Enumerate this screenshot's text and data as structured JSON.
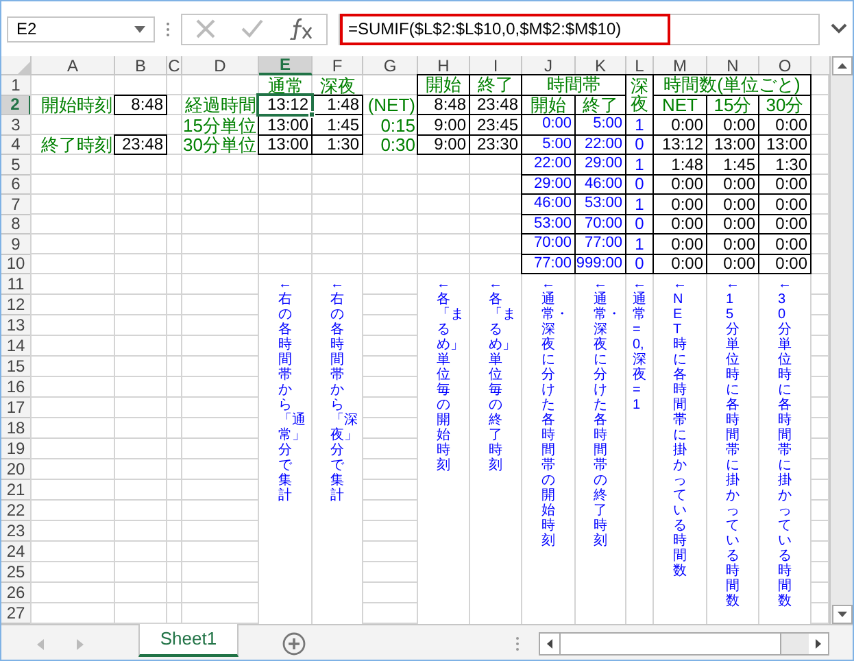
{
  "formula_bar": {
    "name_box": "E2",
    "formula": "=SUMIF($L$2:$L$10,0,$M$2:$M$10)",
    "formula_highlighted": true
  },
  "columns": [
    {
      "label": "A",
      "selected": false
    },
    {
      "label": "B",
      "selected": false
    },
    {
      "label": "C",
      "selected": false
    },
    {
      "label": "D",
      "selected": false
    },
    {
      "label": "E",
      "selected": true
    },
    {
      "label": "F",
      "selected": false
    },
    {
      "label": "G",
      "selected": false
    },
    {
      "label": "H",
      "selected": false
    },
    {
      "label": "I",
      "selected": false
    },
    {
      "label": "J",
      "selected": false
    },
    {
      "label": "K",
      "selected": false
    },
    {
      "label": "L",
      "selected": false
    },
    {
      "label": "M",
      "selected": false
    },
    {
      "label": "N",
      "selected": false
    },
    {
      "label": "O",
      "selected": false
    }
  ],
  "rows": [
    {
      "label": "1",
      "selected": false,
      "cells": {
        "E": {
          "kind": "heading",
          "text": "通常",
          "selected": false
        },
        "F": {
          "kind": "heading",
          "text": "深夜",
          "selected": false
        },
        "H": {
          "kind": "header",
          "text": "開始",
          "selected": false
        },
        "I": {
          "kind": "header",
          "text": "終了",
          "selected": false
        },
        "J": {
          "kind": "header",
          "text": "時間帯",
          "selected": false
        },
        "K": {
          "merged_left": true
        },
        "L": {
          "kind": "header",
          "text": "深夜",
          "selected": false
        },
        "M": {
          "kind": "header",
          "text": "時間数(単位ごと)",
          "selected": false
        },
        "N": {
          "merged_left": true
        },
        "O": {
          "merged_left": true
        }
      }
    },
    {
      "label": "2",
      "selected": true,
      "cells": {
        "A": {
          "kind": "label",
          "text": "開始時刻",
          "selected": false
        },
        "B": {
          "kind": "value",
          "text": "8:48",
          "selected": false
        },
        "D": {
          "kind": "label",
          "text": "経過時間",
          "selected": false
        },
        "E": {
          "kind": "value",
          "text": "13:12",
          "selected": true
        },
        "F": {
          "kind": "value",
          "text": "1:48",
          "selected": false
        },
        "G": {
          "kind": "label",
          "text": "(NET)",
          "selected": false
        },
        "H": {
          "kind": "value",
          "text": "8:48",
          "selected": false
        },
        "I": {
          "kind": "value",
          "text": "23:48",
          "selected": false
        },
        "J": {
          "kind": "header",
          "text": "開始",
          "selected": false
        },
        "K": {
          "kind": "header",
          "text": "終了",
          "selected": false
        },
        "L": {
          "merged_up": true
        },
        "M": {
          "kind": "header",
          "text": "NET",
          "selected": false
        },
        "N": {
          "kind": "header",
          "text": "15分",
          "selected": false
        },
        "O": {
          "kind": "header",
          "text": "30分",
          "selected": false
        }
      }
    },
    {
      "label": "3",
      "selected": false,
      "cells": {
        "D": {
          "kind": "label",
          "text": "15分単位",
          "selected": false
        },
        "E": {
          "kind": "value",
          "text": "13:00",
          "selected": false
        },
        "F": {
          "kind": "value",
          "text": "1:45",
          "selected": false
        },
        "G": {
          "kind": "label",
          "text": "0:15",
          "selected": false
        },
        "H": {
          "kind": "value",
          "text": "9:00",
          "selected": false
        },
        "I": {
          "kind": "value",
          "text": "23:45",
          "selected": false
        },
        "J": {
          "kind": "band",
          "text": "0:00",
          "selected": false
        },
        "K": {
          "kind": "band",
          "text": "5:00",
          "selected": false
        },
        "L": {
          "kind": "flag",
          "text": "1",
          "selected": false
        },
        "M": {
          "kind": "value",
          "text": "0:00",
          "selected": false
        },
        "N": {
          "kind": "value",
          "text": "0:00",
          "selected": false
        },
        "O": {
          "kind": "value",
          "text": "0:00",
          "selected": false
        }
      }
    },
    {
      "label": "4",
      "selected": false,
      "cells": {
        "A": {
          "kind": "label",
          "text": "終了時刻",
          "selected": false
        },
        "B": {
          "kind": "value",
          "text": "23:48",
          "selected": false
        },
        "D": {
          "kind": "label",
          "text": "30分単位",
          "selected": false
        },
        "E": {
          "kind": "value",
          "text": "13:00",
          "selected": false
        },
        "F": {
          "kind": "value",
          "text": "1:30",
          "selected": false
        },
        "G": {
          "kind": "label",
          "text": "0:30",
          "selected": false
        },
        "H": {
          "kind": "value",
          "text": "9:00",
          "selected": false
        },
        "I": {
          "kind": "value",
          "text": "23:30",
          "selected": false
        },
        "J": {
          "kind": "band",
          "text": "5:00",
          "selected": false
        },
        "K": {
          "kind": "band",
          "text": "22:00",
          "selected": false
        },
        "L": {
          "kind": "flag",
          "text": "0",
          "selected": false
        },
        "M": {
          "kind": "value",
          "text": "13:12",
          "selected": false
        },
        "N": {
          "kind": "value",
          "text": "13:00",
          "selected": false
        },
        "O": {
          "kind": "value",
          "text": "13:00",
          "selected": false
        }
      }
    },
    {
      "label": "5",
      "selected": false,
      "cells": {
        "J": {
          "kind": "band",
          "text": "22:00",
          "selected": false
        },
        "K": {
          "kind": "band",
          "text": "29:00",
          "selected": false
        },
        "L": {
          "kind": "flag",
          "text": "1",
          "selected": false
        },
        "M": {
          "kind": "value",
          "text": "1:48",
          "selected": false
        },
        "N": {
          "kind": "value",
          "text": "1:45",
          "selected": false
        },
        "O": {
          "kind": "value",
          "text": "1:30",
          "selected": false
        }
      }
    },
    {
      "label": "6",
      "selected": false,
      "cells": {
        "J": {
          "kind": "band",
          "text": "29:00",
          "selected": false
        },
        "K": {
          "kind": "band",
          "text": "46:00",
          "selected": false
        },
        "L": {
          "kind": "flag",
          "text": "0",
          "selected": false
        },
        "M": {
          "kind": "value",
          "text": "0:00",
          "selected": false
        },
        "N": {
          "kind": "value",
          "text": "0:00",
          "selected": false
        },
        "O": {
          "kind": "value",
          "text": "0:00",
          "selected": false
        }
      }
    },
    {
      "label": "7",
      "selected": false,
      "cells": {
        "J": {
          "kind": "band",
          "text": "46:00",
          "selected": false
        },
        "K": {
          "kind": "band",
          "text": "53:00",
          "selected": false
        },
        "L": {
          "kind": "flag",
          "text": "1",
          "selected": false
        },
        "M": {
          "kind": "value",
          "text": "0:00",
          "selected": false
        },
        "N": {
          "kind": "value",
          "text": "0:00",
          "selected": false
        },
        "O": {
          "kind": "value",
          "text": "0:00",
          "selected": false
        }
      }
    },
    {
      "label": "8",
      "selected": false,
      "cells": {
        "J": {
          "kind": "band",
          "text": "53:00",
          "selected": false
        },
        "K": {
          "kind": "band",
          "text": "70:00",
          "selected": false
        },
        "L": {
          "kind": "flag",
          "text": "0",
          "selected": false
        },
        "M": {
          "kind": "value",
          "text": "0:00",
          "selected": false
        },
        "N": {
          "kind": "value",
          "text": "0:00",
          "selected": false
        },
        "O": {
          "kind": "value",
          "text": "0:00",
          "selected": false
        }
      }
    },
    {
      "label": "9",
      "selected": false,
      "cells": {
        "J": {
          "kind": "band",
          "text": "70:00",
          "selected": false
        },
        "K": {
          "kind": "band",
          "text": "77:00",
          "selected": false
        },
        "L": {
          "kind": "flag",
          "text": "1",
          "selected": false
        },
        "M": {
          "kind": "value",
          "text": "0:00",
          "selected": false
        },
        "N": {
          "kind": "value",
          "text": "0:00",
          "selected": false
        },
        "O": {
          "kind": "value",
          "text": "0:00",
          "selected": false
        }
      }
    },
    {
      "label": "10",
      "selected": false,
      "cells": {
        "J": {
          "kind": "band",
          "text": "77:00",
          "selected": false
        },
        "K": {
          "kind": "band",
          "text": "999:00",
          "selected": false
        },
        "L": {
          "kind": "flag",
          "text": "0",
          "selected": false
        },
        "M": {
          "kind": "value",
          "text": "0:00",
          "selected": false
        },
        "N": {
          "kind": "value",
          "text": "0:00",
          "selected": false
        },
        "O": {
          "kind": "value",
          "text": "0:00",
          "selected": false
        }
      }
    },
    {
      "label": "11",
      "selected": false,
      "cells": {
        "E": {
          "kind": "note",
          "text": "←右の各時間帯から「通常」分で集計",
          "selected": false
        },
        "F": {
          "kind": "note",
          "text": "←右の各時間帯から「深夜」分で集計",
          "selected": false
        },
        "H": {
          "kind": "note",
          "text": "←各「まるめ」単位毎の開始時刻",
          "selected": false
        },
        "I": {
          "kind": "note",
          "text": "←各「まるめ」単位毎の終了時刻",
          "selected": false
        },
        "J": {
          "kind": "note",
          "text": "←通常・深夜に分けた各時間帯の開始時刻",
          "selected": false
        },
        "K": {
          "kind": "note",
          "text": "←通常・深夜に分けた各時間帯の終了時刻",
          "selected": false
        },
        "L": {
          "kind": "note",
          "text": "←通常=0, 深夜=1",
          "selected": false
        },
        "M": {
          "kind": "note",
          "text": "←NET時に各時間帯に掛かっている時間数",
          "selected": false
        },
        "N": {
          "kind": "note",
          "text": "←15分単位時に各時間帯に掛かっている時間数",
          "selected": false
        },
        "O": {
          "kind": "note",
          "text": "←30分単位時に各時間帯に掛かっている時間数",
          "selected": false
        }
      }
    },
    {
      "label": "12",
      "selected": false
    },
    {
      "label": "13",
      "selected": false
    },
    {
      "label": "14",
      "selected": false
    },
    {
      "label": "15",
      "selected": false
    },
    {
      "label": "16",
      "selected": false
    },
    {
      "label": "17",
      "selected": false
    },
    {
      "label": "18",
      "selected": false
    },
    {
      "label": "19",
      "selected": false
    },
    {
      "label": "20",
      "selected": false
    },
    {
      "label": "21",
      "selected": false
    },
    {
      "label": "22",
      "selected": false
    },
    {
      "label": "23",
      "selected": false
    },
    {
      "label": "24",
      "selected": false
    },
    {
      "label": "25",
      "selected": false
    },
    {
      "label": "26",
      "selected": false
    },
    {
      "label": "27",
      "selected": false
    }
  ],
  "sheet_tabs": [
    {
      "label": "Sheet1",
      "selected": true
    }
  ]
}
